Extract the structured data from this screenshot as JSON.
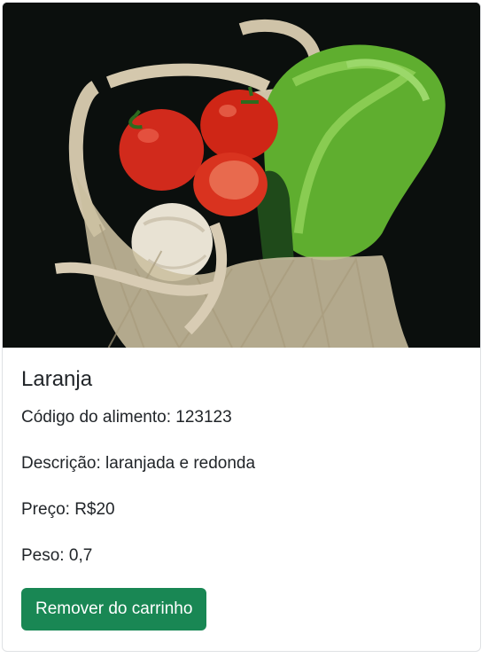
{
  "product": {
    "image_alt": "Vegetables in mesh bag",
    "title": "Laranja",
    "code_label": "Código do alimento:",
    "code_value": "123123",
    "description_label": "Descrição:",
    "description_value": "laranjada e redonda",
    "price_label": "Preço:",
    "price_value": "R$20",
    "weight_label": "Peso:",
    "weight_value": "0,7"
  },
  "actions": {
    "remove_label": "Remover do carrinho"
  },
  "colors": {
    "button_bg": "#198754",
    "image_bg": "#0b0f0d",
    "tomato": "#d12a1c",
    "lettuce": "#5fae2f",
    "bag": "#d8ccb4",
    "onion": "#e8e2d3"
  }
}
